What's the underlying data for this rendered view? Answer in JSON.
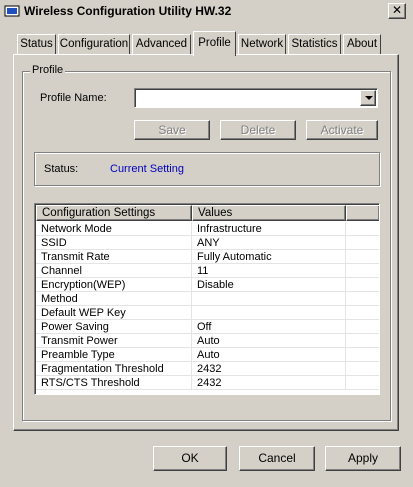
{
  "window": {
    "title": "Wireless Configuration Utility HW.32",
    "close_glyph": "✕"
  },
  "tabs": [
    {
      "label": "Status"
    },
    {
      "label": "Configuration"
    },
    {
      "label": "Advanced"
    },
    {
      "label": "Profile",
      "active": true
    },
    {
      "label": "Network"
    },
    {
      "label": "Statistics"
    },
    {
      "label": "About"
    }
  ],
  "profile": {
    "group_label": "Profile",
    "name_label": "Profile Name:",
    "name_value": "",
    "save_label": "Save",
    "delete_label": "Delete",
    "activate_label": "Activate",
    "status_label": "Status:",
    "status_value": "Current Setting"
  },
  "config_table": {
    "columns": [
      "Configuration Settings",
      "Values"
    ],
    "rows": [
      [
        "Network Mode",
        "Infrastructure"
      ],
      [
        "SSID",
        "ANY"
      ],
      [
        "Transmit Rate",
        "Fully Automatic"
      ],
      [
        "Channel",
        "11"
      ],
      [
        "Encryption(WEP)",
        "Disable"
      ],
      [
        "Method",
        ""
      ],
      [
        "Default WEP Key",
        ""
      ],
      [
        "Power Saving",
        "Off"
      ],
      [
        "Transmit Power",
        "Auto"
      ],
      [
        "Preamble Type",
        "Auto"
      ],
      [
        "Fragmentation Threshold",
        "2432"
      ],
      [
        "RTS/CTS Threshold",
        "2432"
      ]
    ]
  },
  "footer": {
    "ok_label": "OK",
    "cancel_label": "Cancel",
    "apply_label": "Apply"
  },
  "colors": {
    "face": "#d4d0c8",
    "status_text": "#0000c0"
  },
  "icons": {
    "app": "wireless-app-icon",
    "close": "close-icon",
    "dropdown": "chevron-down-icon"
  }
}
